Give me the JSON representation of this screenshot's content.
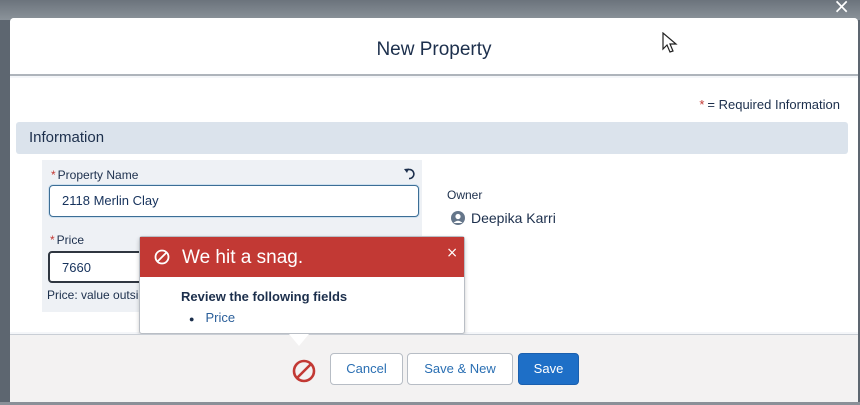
{
  "modal": {
    "title": "New Property",
    "close_icon": "close-icon"
  },
  "form": {
    "required_note_star": "*",
    "required_note_text": "= Required Information",
    "section_title": "Information",
    "property_name": {
      "required_mark": "*",
      "label": "Property Name",
      "value": "2118 Merlin Clay"
    },
    "price": {
      "required_mark": "*",
      "label": "Price",
      "value": "7660",
      "error_text": "Price: value outsi"
    },
    "owner": {
      "label": "Owner",
      "name": "Deepika Karri",
      "avatar_icon": "user-avatar-icon"
    }
  },
  "error_popover": {
    "title": "We hit a snag.",
    "close_label": "×",
    "subtitle": "Review the following fields",
    "fields": [
      "Price"
    ]
  },
  "footer": {
    "cancel_label": "Cancel",
    "save_new_label": "Save & New",
    "save_label": "Save"
  },
  "colors": {
    "error_red": "#c23934",
    "brand_blue": "#1e6fc7",
    "link_blue": "#2a6fb3",
    "section_bg": "#dbe3ec"
  }
}
